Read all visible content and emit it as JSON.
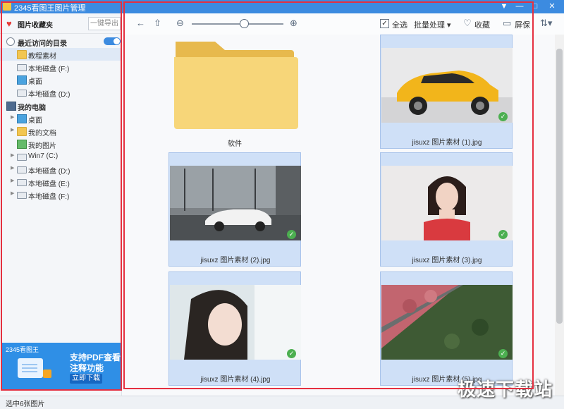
{
  "window": {
    "title": "2345看图王图片管理"
  },
  "sidebar": {
    "favorites_label": "图片收藏夹",
    "export_label": "一键导出",
    "recent_label": "最近访问的目录",
    "recent_items": [
      {
        "label": "教程素材",
        "icon": "folder-icon"
      },
      {
        "label": "本地磁盘 (F:)",
        "icon": "drive-icon"
      },
      {
        "label": "桌面",
        "icon": "desktop-icon"
      },
      {
        "label": "本地磁盘 (D:)",
        "icon": "drive-icon"
      }
    ],
    "computer_label": "我的电脑",
    "computer_items": [
      {
        "label": "桌面",
        "icon": "desktop-icon"
      },
      {
        "label": "我的文档",
        "icon": "folder-icon"
      },
      {
        "label": "我的图片",
        "icon": "pictures-icon"
      },
      {
        "label": "Win7 (C:)",
        "icon": "drive-icon"
      },
      {
        "label": "本地磁盘 (D:)",
        "icon": "drive-icon"
      },
      {
        "label": "本地磁盘 (E:)",
        "icon": "drive-icon"
      },
      {
        "label": "本地磁盘 (F:)",
        "icon": "drive-icon"
      }
    ]
  },
  "ad": {
    "brand": "2345看图王",
    "line1": "支持PDF查看",
    "line2": "注释功能",
    "button": "立即下载"
  },
  "toolbar": {
    "select_all": "全选",
    "batch": "批量处理",
    "favorite": "收藏",
    "screen": "屏保"
  },
  "content": {
    "items": [
      {
        "name": "软件",
        "type": "folder",
        "selected": false
      },
      {
        "name": "jisuxz 图片素材 (1).jpg",
        "type": "image",
        "selected": true
      },
      {
        "name": "jisuxz 图片素材 (2).jpg",
        "type": "image",
        "selected": true
      },
      {
        "name": "jisuxz 图片素材 (3).jpg",
        "type": "image",
        "selected": true
      },
      {
        "name": "jisuxz 图片素材 (4).jpg",
        "type": "image",
        "selected": true
      },
      {
        "name": "jisuxz 图片素材 (5).jpg",
        "type": "image",
        "selected": true
      }
    ]
  },
  "status": {
    "text": "选中6张图片"
  },
  "watermark": "极速下载站",
  "colors": {
    "accent": "#3c8be0",
    "highlight": "#e53040",
    "selection": "#cfe0f7"
  }
}
